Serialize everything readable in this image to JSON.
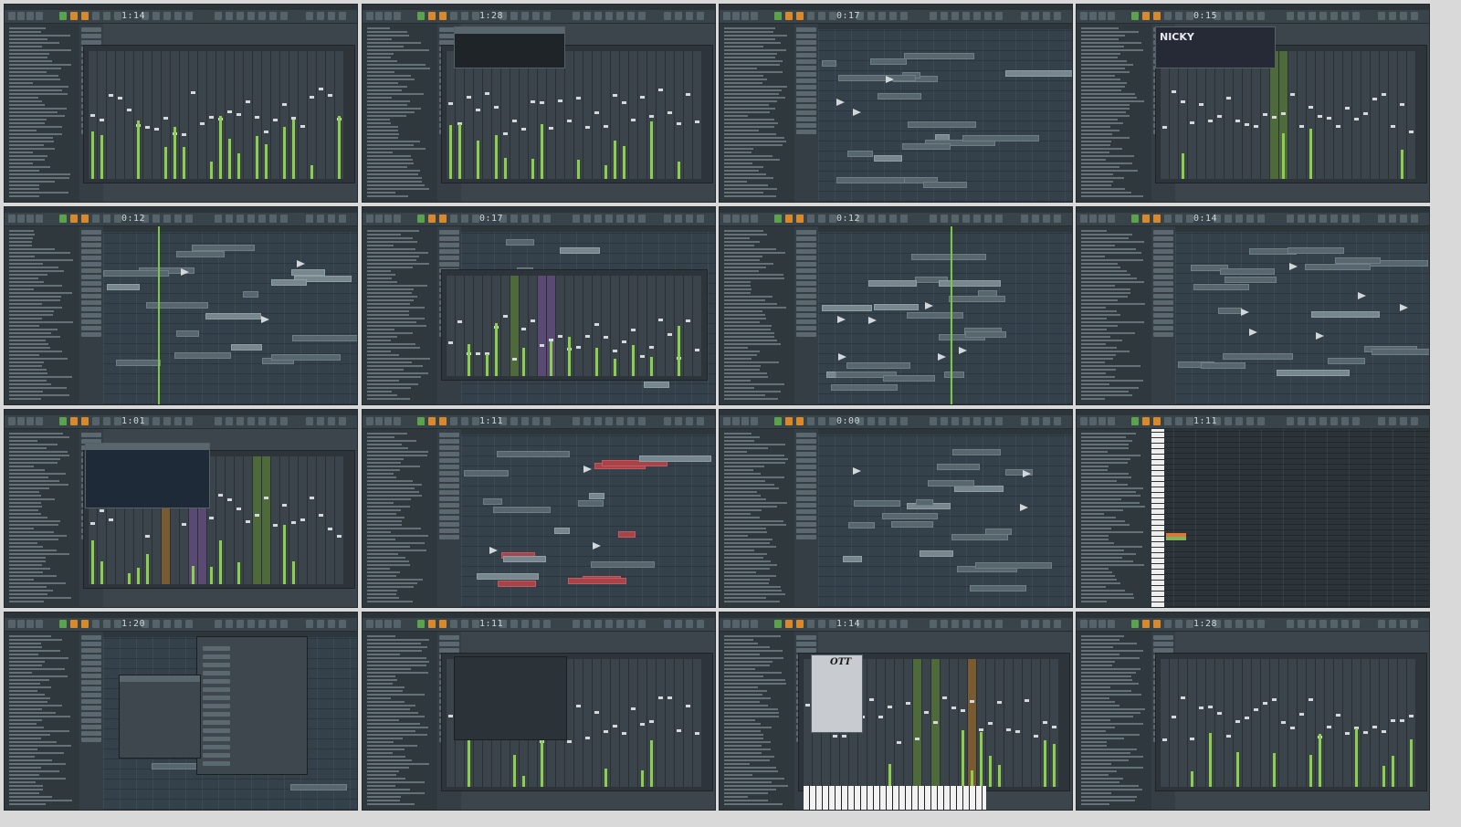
{
  "layout": "4x4 contact sheet of FL Studio screenshots",
  "frames": [
    {
      "clock": "1:14",
      "view": "mixer"
    },
    {
      "clock": "1:28",
      "view": "mixer-plugin"
    },
    {
      "clock": "0:17",
      "view": "playlist"
    },
    {
      "clock": "0:15",
      "view": "mixer-nicky"
    },
    {
      "clock": "0:12",
      "view": "playlist"
    },
    {
      "clock": "0:17",
      "view": "playlist-mixer"
    },
    {
      "clock": "0:12",
      "view": "playlist"
    },
    {
      "clock": "0:14",
      "view": "playlist"
    },
    {
      "clock": "1:01",
      "view": "mixer-eq"
    },
    {
      "clock": "1:11",
      "view": "playlist-red"
    },
    {
      "clock": "0:00",
      "view": "playlist"
    },
    {
      "clock": "1:11",
      "view": "pianoroll"
    },
    {
      "clock": "1:20",
      "view": "channel-rack"
    },
    {
      "clock": "1:11",
      "view": "mixer-dialog"
    },
    {
      "clock": "1:14",
      "view": "mixer-ott"
    },
    {
      "clock": "1:28",
      "view": "mixer"
    }
  ],
  "plugin_labels": {
    "ott": "OTT",
    "nicky": "NICKY"
  },
  "colors": {
    "accent_orange": "#d9892a",
    "playhead_green": "#7ac943",
    "clip_red": "#a8434a",
    "bg": "#3b454b"
  }
}
